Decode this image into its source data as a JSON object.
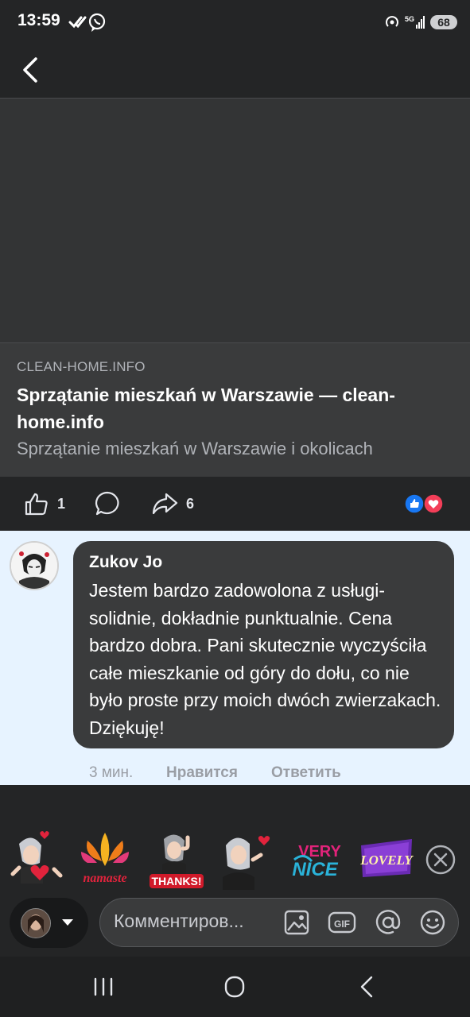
{
  "status": {
    "time": "13:59",
    "battery": "68",
    "network": "5G"
  },
  "link_preview": {
    "domain": "CLEAN-HOME.INFO",
    "title": "Sprzątanie mieszkań w Warszawie — clean-home.info",
    "description": "Sprzątanie mieszkań w Warszawie i okolicach"
  },
  "actions": {
    "like_count": "1",
    "share_count": "6"
  },
  "comment": {
    "author": "Zukov Jo",
    "text": "Jestem bardzo zadowolona z usługi- solidnie, dokładnie  punktualnie. Cena bardzo dobra. Pani skutecznie wyczyściła całe mieszkanie od góry do dołu, co nie było proste przy moich dwóch zwierzakach. Dziękuję!",
    "time": "3 мин.",
    "like_label": "Нравится",
    "reply_label": "Ответить"
  },
  "stickers": [
    {
      "name": "hearts-girl-sticker",
      "text": ""
    },
    {
      "name": "namaste-sticker",
      "text": "namaste"
    },
    {
      "name": "thanks-sticker",
      "text": "THANKS!"
    },
    {
      "name": "kiss-girl-sticker",
      "text": ""
    },
    {
      "name": "very-nice-sticker",
      "text": "VERY NICE"
    },
    {
      "name": "lovely-sticker",
      "text": "LOVELY"
    }
  ],
  "composer": {
    "placeholder": "Комментиров..."
  },
  "colors": {
    "background": "#242526",
    "comment_highlight": "#e7f3ff",
    "bubble": "#3a3b3c",
    "like_blue": "#1877f2",
    "love_red": "#f33e58"
  }
}
